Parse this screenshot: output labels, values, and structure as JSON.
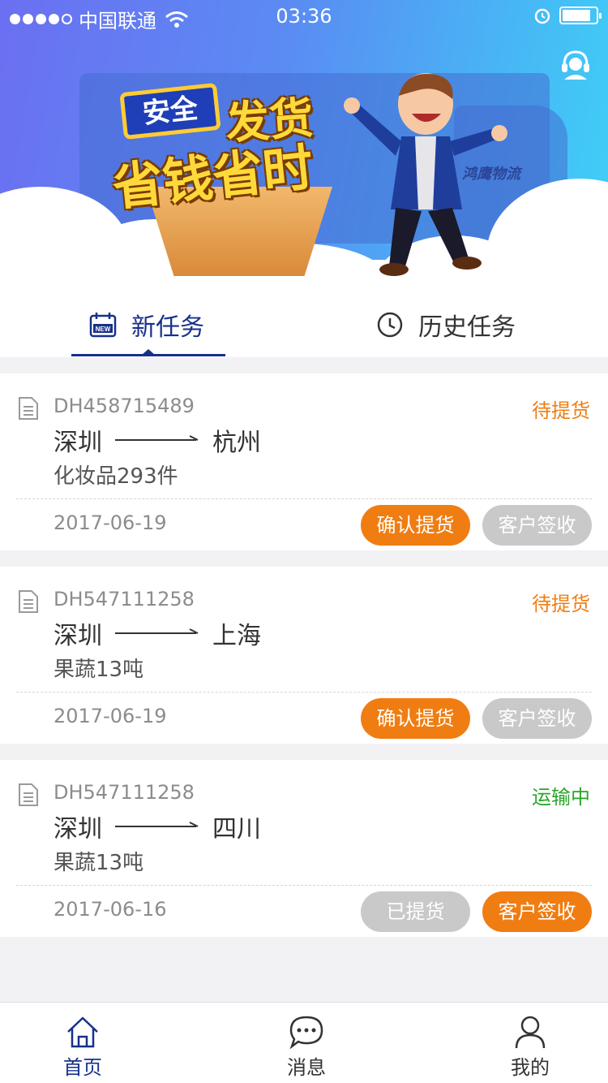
{
  "status_bar": {
    "carrier": "中国联通",
    "time": "03:36"
  },
  "banner": {
    "sign_text": "安全",
    "title_line1": "发货",
    "title_line2": "省钱省时",
    "truck_logo": "鸿鹰物流"
  },
  "tabs": [
    {
      "label": "新任务",
      "active": true,
      "icon": "calendar-new-icon"
    },
    {
      "label": "历史任务",
      "active": false,
      "icon": "clock-icon"
    }
  ],
  "orders": [
    {
      "order_no": "DH458715489",
      "status": "待提货",
      "status_color": "#f07d12",
      "from": "深圳",
      "to": "杭州",
      "cargo": "化妆品293件",
      "date": "2017-06-19",
      "btn_left": {
        "label": "确认提货",
        "style": "orange"
      },
      "btn_right": {
        "label": "客户签收",
        "style": "gray"
      }
    },
    {
      "order_no": "DH547111258",
      "status": "待提货",
      "status_color": "#f07d12",
      "from": "深圳",
      "to": "上海",
      "cargo": "果蔬13吨",
      "date": "2017-06-19",
      "btn_left": {
        "label": "确认提货",
        "style": "orange"
      },
      "btn_right": {
        "label": "客户签收",
        "style": "gray"
      }
    },
    {
      "order_no": "DH547111258",
      "status": "运输中",
      "status_color": "#2aa52a",
      "from": "深圳",
      "to": "四川",
      "cargo": "果蔬13吨",
      "date": "2017-06-16",
      "btn_left": {
        "label": "已提货",
        "style": "gray"
      },
      "btn_right": {
        "label": "客户签收",
        "style": "orange"
      }
    }
  ],
  "bottom_nav": [
    {
      "label": "首页",
      "active": true,
      "icon": "home-icon"
    },
    {
      "label": "消息",
      "active": false,
      "icon": "chat-icon"
    },
    {
      "label": "我的",
      "active": false,
      "icon": "user-icon"
    }
  ],
  "colors": {
    "primary": "#17318a",
    "accent": "#f07d12",
    "in_transit": "#2aa52a"
  }
}
